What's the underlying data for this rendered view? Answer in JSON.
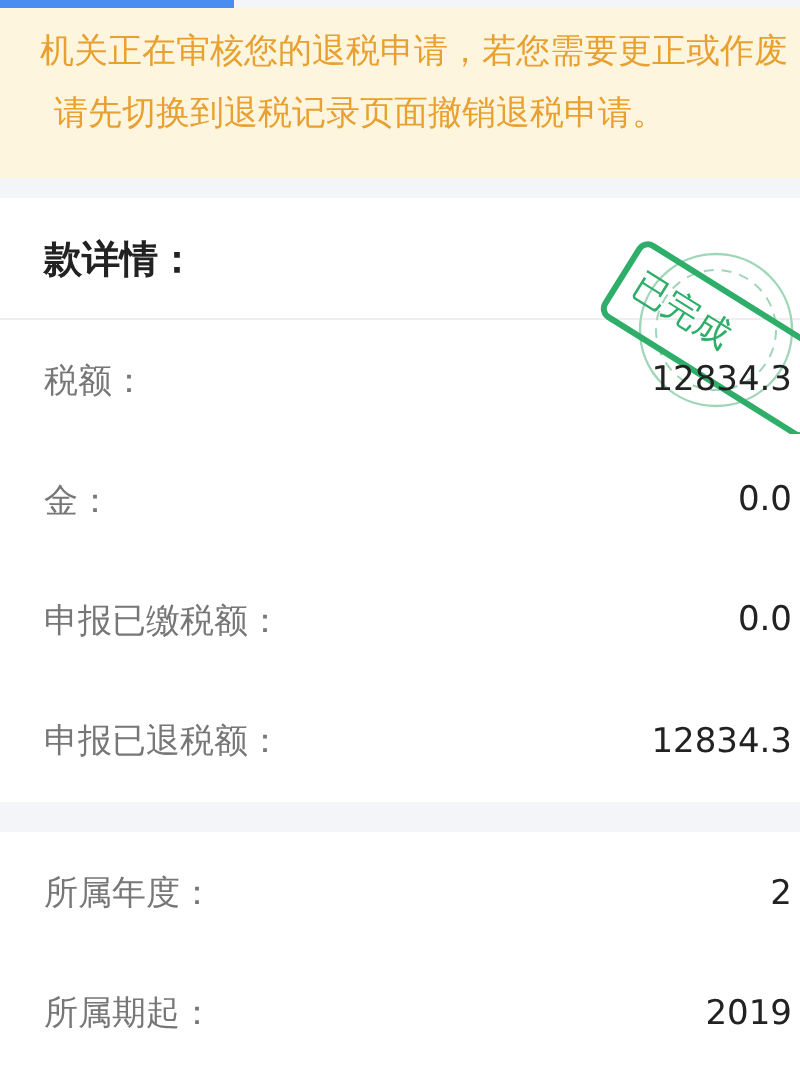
{
  "notice": {
    "lines": [
      "机关正在审核您的退税申请，若您需要更正或作废",
      "请先切换到退税记录页面撤销退税申请。"
    ]
  },
  "details": {
    "title": "款详情：",
    "stamp": {
      "kind": "stamp",
      "text": "已完成"
    },
    "rows": [
      {
        "label": "税额：",
        "value": "12834.3"
      },
      {
        "label": "金：",
        "value": "0.0"
      },
      {
        "label": "申报已缴税额：",
        "value": "0.0"
      },
      {
        "label": "申报已退税额：",
        "value": "12834.3"
      }
    ]
  },
  "period": {
    "rows": [
      {
        "label": "所属年度：",
        "value": "2"
      },
      {
        "label": "所属期起：",
        "value": "2019"
      }
    ]
  }
}
